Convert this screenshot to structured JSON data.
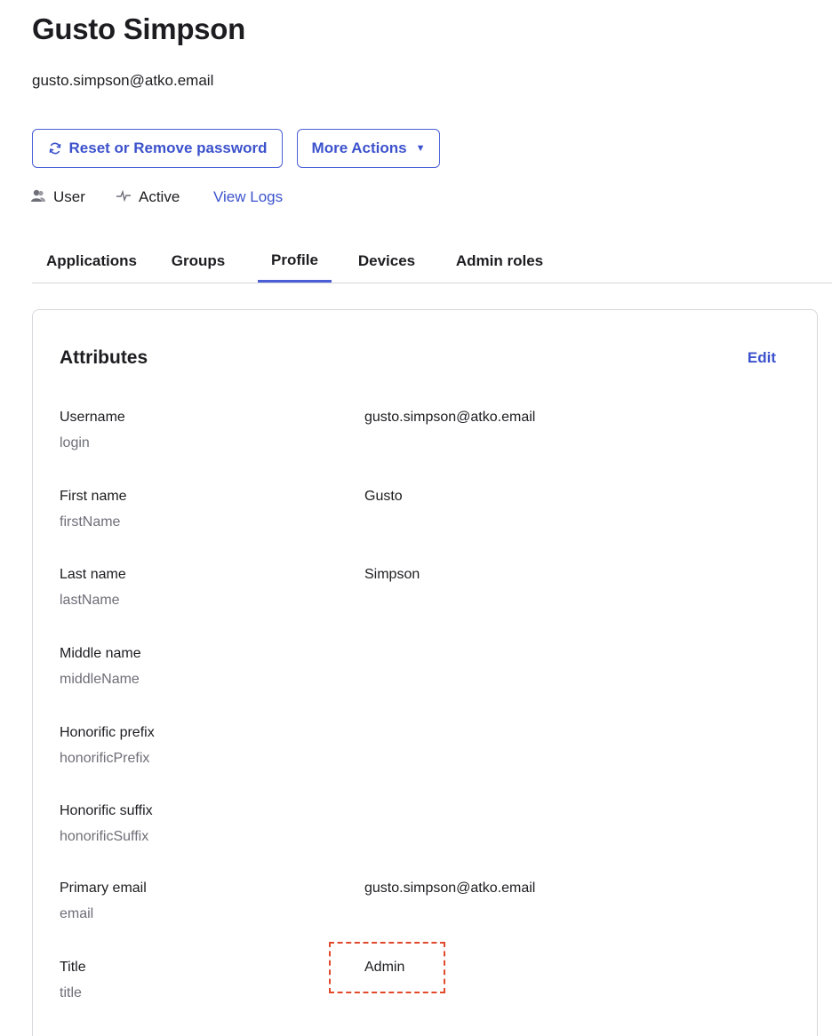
{
  "user": {
    "name": "Gusto Simpson",
    "email": "gusto.simpson@atko.email"
  },
  "actions": {
    "reset_label": "Reset or Remove password",
    "more_label": "More Actions",
    "more_caret": "▼"
  },
  "meta": {
    "type": "User",
    "status": "Active",
    "logs_link": "View Logs"
  },
  "tabs": [
    {
      "label": "Applications",
      "active": false
    },
    {
      "label": "Groups",
      "active": false
    },
    {
      "label": "Profile",
      "active": true
    },
    {
      "label": "Devices",
      "active": false
    },
    {
      "label": "Admin roles",
      "active": false
    }
  ],
  "attributes": {
    "title": "Attributes",
    "edit_label": "Edit",
    "rows": [
      {
        "label": "Username",
        "key": "login",
        "value": "gusto.simpson@atko.email"
      },
      {
        "label": "First name",
        "key": "firstName",
        "value": "Gusto"
      },
      {
        "label": "Last name",
        "key": "lastName",
        "value": "Simpson"
      },
      {
        "label": "Middle name",
        "key": "middleName",
        "value": ""
      },
      {
        "label": "Honorific prefix",
        "key": "honorificPrefix",
        "value": ""
      },
      {
        "label": "Honorific suffix",
        "key": "honorificSuffix",
        "value": ""
      },
      {
        "label": "Primary email",
        "key": "email",
        "value": "gusto.simpson@atko.email"
      },
      {
        "label": "Title",
        "key": "title",
        "value": "Admin"
      }
    ]
  },
  "colors": {
    "accent": "#3c52cc",
    "highlight": "#e0492b"
  }
}
